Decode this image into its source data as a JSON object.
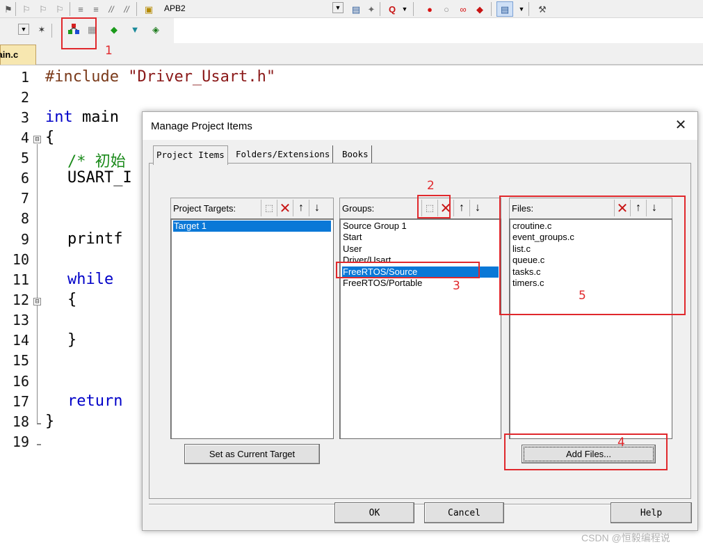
{
  "toolbar1": {
    "target_name": "APB2",
    "icons": [
      "flag-icon",
      "bookmark-prev-icon",
      "bookmark-next-icon",
      "bookmark-clear-icon",
      "indent-icon",
      "unindent-icon",
      "comment-icon",
      "uncomment-icon",
      "open-file-icon",
      "dropdown-icon",
      "find-in-files-icon",
      "debug-icon",
      "zoom-icon",
      "breakpoint-insert-icon",
      "breakpoint-disable-icon",
      "breakpoints-icon",
      "breakpoint-kill-icon",
      "window-menu-icon",
      "configure-icon"
    ]
  },
  "toolbar2": {
    "icons": [
      "dropdown-icon",
      "options-magic-wand-icon",
      "manage-project-items-icon",
      "select-software-packs-icon",
      "manage-runtime-icon",
      "pack-installer-icon",
      "pack-install-chip-icon"
    ]
  },
  "editor": {
    "tab_label": "main.c",
    "line_numbers": [
      "1",
      "2",
      "3",
      "4",
      "5",
      "6",
      "7",
      "8",
      "9",
      "10",
      "11",
      "12",
      "13",
      "14",
      "15",
      "16",
      "17",
      "18",
      "19"
    ],
    "lines": {
      "l1_directive": "#include",
      "l1_string": "\"Driver_Usart.h\"",
      "l3_type": "int",
      "l3_rest": "main",
      "l4": "{",
      "l5": "/* 初始",
      "l6": "USART_I",
      "l9": "printf",
      "l11": "while",
      "l12": "{",
      "l14": "}",
      "l17": "return",
      "l18": "}"
    }
  },
  "dialog": {
    "title": "Manage Project Items",
    "close_glyph": "✕",
    "tabs": [
      "Project Items",
      "Folders/Extensions",
      "Books"
    ],
    "project_targets": {
      "label": "Project Targets:",
      "items": [
        "Target 1"
      ],
      "selected": "Target 1"
    },
    "groups": {
      "label": "Groups:",
      "items": [
        "Source Group 1",
        "Start",
        "User",
        "Driver/Usart",
        "FreeRTOS/Source",
        "FreeRTOS/Portable"
      ],
      "selected": "FreeRTOS/Source"
    },
    "files": {
      "label": "Files:",
      "items": [
        "croutine.c",
        "event_groups.c",
        "list.c",
        "queue.c",
        "tasks.c",
        "timers.c"
      ]
    },
    "buttons": {
      "set_current_target": "Set as Current Target",
      "add_files": "Add Files...",
      "ok": "OK",
      "cancel": "Cancel",
      "help": "Help"
    },
    "tool_glyphs": {
      "new": "⬚",
      "delete": "✕",
      "up": "↑",
      "down": "↓"
    }
  },
  "annotations": {
    "markers": [
      "1",
      "2",
      "3",
      "4",
      "5"
    ],
    "color": "#e0282c"
  },
  "watermark": "CSDN @恒毅编程说"
}
